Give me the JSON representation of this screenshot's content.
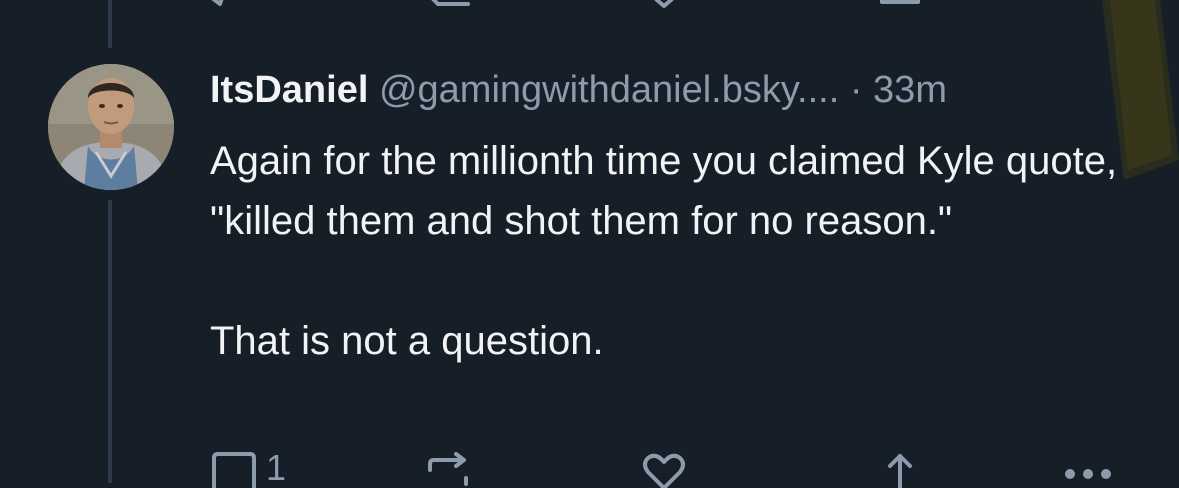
{
  "post": {
    "author": {
      "display_name": "ItsDaniel",
      "handle": "@gamingwithdaniel.bsky....",
      "separator": "·",
      "time": "33m"
    },
    "body": {
      "paragraph_1": "Again for the millionth time you claimed Kyle quote, \"killed them and shot them for no reason.\"",
      "paragraph_2": "That is not a question."
    },
    "actions": {
      "reply_count": "1",
      "reply_icon": "reply-bubble-icon",
      "repost_icon": "repost-icon",
      "like_icon": "heart-icon",
      "share_icon": "share-icon",
      "more_icon": "more-dots-icon"
    }
  },
  "colors": {
    "background": "#161e27",
    "text": "#f1f3f5",
    "muted": "#8d9cad",
    "thread_line": "#2e3b4b",
    "highlight": "#b8a21a"
  }
}
